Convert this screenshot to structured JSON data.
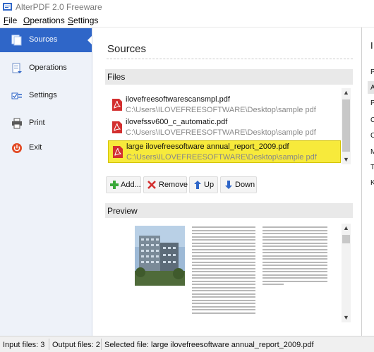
{
  "window": {
    "title": "AlterPDF 2.0 Freeware"
  },
  "menu": {
    "file": {
      "mnemonic": "F",
      "rest": "ile"
    },
    "operations": {
      "mnemonic": "O",
      "rest": "perations"
    },
    "settings": {
      "mnemonic": "S",
      "rest": "ettings"
    }
  },
  "sidebar": {
    "items": [
      {
        "label": "Sources",
        "icon": "sources-icon",
        "active": true
      },
      {
        "label": "Operations",
        "icon": "operations-icon",
        "active": false
      },
      {
        "label": "Settings",
        "icon": "settings-icon",
        "active": false
      },
      {
        "label": "Print",
        "icon": "printer-icon",
        "active": false
      },
      {
        "label": "Exit",
        "icon": "power-icon",
        "active": false
      }
    ]
  },
  "main": {
    "title": "Sources",
    "files_header": "Files",
    "preview_header": "Preview",
    "files": [
      {
        "name": "ilovefreesoftwarescansmpl.pdf",
        "path": "C:\\Users\\ILOVEFREESOFTWARE\\Desktop\\sample pdf"
      },
      {
        "name": "ilovefssv600_c_automatic.pdf",
        "path": "C:\\Users\\ILOVEFREESOFTWARE\\Desktop\\sample pdf"
      },
      {
        "name": "large ilovefreesoftware annual_report_2009.pdf",
        "path": "C:\\Users\\ILOVEFREESOFTWARE\\Desktop\\sample pdf",
        "selected": true
      }
    ],
    "buttons": {
      "add": "Add...",
      "remove": "Remove",
      "up": "Up",
      "down": "Down"
    }
  },
  "right_panel": {
    "header": "I",
    "items": [
      "P",
      "A",
      "P",
      "C",
      "C",
      "M",
      "T",
      "K"
    ]
  },
  "status": {
    "input_files": "Input files: 3",
    "output_files": "Output files: 2",
    "selected_file": "Selected file: large ilovefreesoftware annual_report_2009.pdf"
  },
  "colors": {
    "accent": "#2f66c8",
    "selection": "#f7ea3b",
    "sidebar_bg": "#eef2f9",
    "pdf_red": "#d32f2f"
  }
}
